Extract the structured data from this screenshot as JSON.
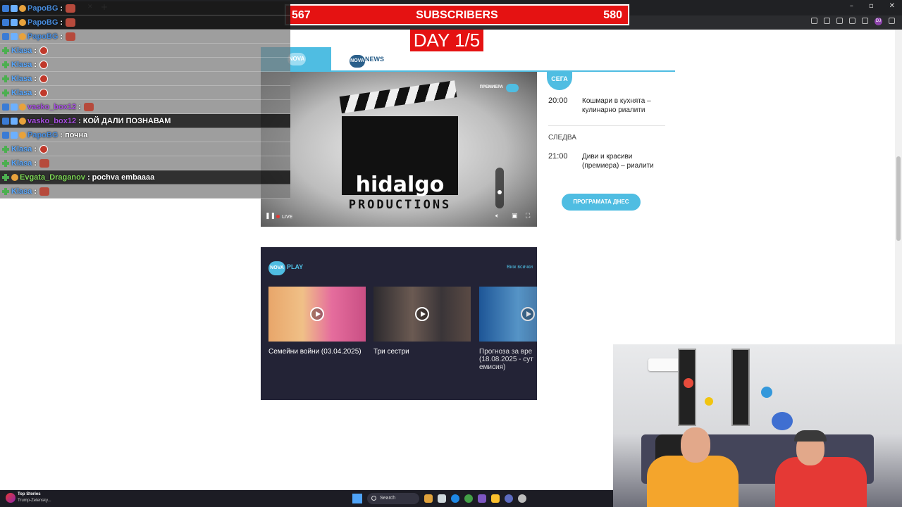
{
  "overlay": {
    "subs_current": "567",
    "subs_label": "SUBSCRIBERS",
    "subs_goal": "580",
    "day_label": "DAY 1/5"
  },
  "chat": [
    {
      "user": "PapoBG",
      "color": "#4a8fe0",
      "message": "",
      "emote": "square",
      "style": "dark",
      "badges": [
        "mod",
        "sub",
        "face"
      ]
    },
    {
      "user": "PapoBG",
      "color": "#4a8fe0",
      "message": "",
      "emote": "square",
      "style": "dark",
      "badges": [
        "mod",
        "sub",
        "face"
      ]
    },
    {
      "user": "PapoBG",
      "color": "#4a8fe0",
      "message": "",
      "emote": "square",
      "style": "light",
      "badges": [
        "mod",
        "sub",
        "face"
      ]
    },
    {
      "user": "Klasa",
      "color": "#5aa9ff",
      "message": "",
      "emote": "round",
      "style": "light",
      "badges": [
        "plus"
      ]
    },
    {
      "user": "Klasa",
      "color": "#5aa9ff",
      "message": "",
      "emote": "round",
      "style": "light",
      "badges": [
        "plus"
      ]
    },
    {
      "user": "Klasa",
      "color": "#5aa9ff",
      "message": "",
      "emote": "round",
      "style": "light",
      "badges": [
        "plus"
      ]
    },
    {
      "user": "Klasa",
      "color": "#5aa9ff",
      "message": "",
      "emote": "round",
      "style": "light",
      "badges": [
        "plus"
      ]
    },
    {
      "user": "vasko_box12",
      "color": "#a74ee0",
      "message": "",
      "emote": "square",
      "style": "light",
      "badges": [
        "mod",
        "sub",
        "face"
      ]
    },
    {
      "user": "vasko_box12",
      "color": "#a74ee0",
      "message": "КОЙ ДАЛИ ПОЗНАВАМ",
      "emote": "",
      "style": "dark",
      "badges": [
        "mod",
        "sub",
        "face"
      ]
    },
    {
      "user": "PapoBG",
      "color": "#4a8fe0",
      "message": "почна",
      "emote": "",
      "style": "light",
      "badges": [
        "mod",
        "sub",
        "face"
      ]
    },
    {
      "user": "Klasa",
      "color": "#5aa9ff",
      "message": "",
      "emote": "round",
      "style": "light",
      "badges": [
        "plus"
      ]
    },
    {
      "user": "Klasa",
      "color": "#5aa9ff",
      "message": "",
      "emote": "square",
      "style": "light",
      "badges": [
        "plus"
      ]
    },
    {
      "user": "Evgata_Draganov",
      "color": "#7ed957",
      "message": "pochva embaaaa",
      "emote": "",
      "style": "dark",
      "badges": [
        "plus",
        "face"
      ]
    },
    {
      "user": "Klasa",
      "color": "#5aa9ff",
      "message": "",
      "emote": "square",
      "style": "light",
      "badges": [
        "plus"
      ]
    }
  ],
  "site": {
    "tab_nova_logo": "NOVA",
    "tab_news_badge": "NOVA",
    "tab_news_label": "NEWS"
  },
  "player": {
    "premiere_label": "ПРЕМИЕРА",
    "hidalgo_text": "hidalgo",
    "productions_text": "PRODUCTIONS",
    "live_label": "LIVE",
    "volume_level": 0.4
  },
  "schedule": {
    "now_label": "СЕГА",
    "now_time": "20:00",
    "now_title": "Кошмари в кухнята – кулинарно риалити",
    "next_label": "СЛЕДВА",
    "next_time": "21:00",
    "next_title": "Диви и красиви (премиера) – риалити",
    "button_label": "ПРОГРАМАТА ДНЕС"
  },
  "play": {
    "logo_badge": "NOVA",
    "logo_text": "PLAY",
    "see_all": "Виж всички",
    "cards": [
      {
        "title": "Семейни войни (03.04.2025)"
      },
      {
        "title": "Три сестри"
      },
      {
        "title": "Прогноза за вре (18.08.2025 - сут емисия)"
      }
    ]
  },
  "taskbar": {
    "news_title": "Top Stories",
    "news_sub": "Trump-Zelensky...",
    "search_label": "Search"
  }
}
